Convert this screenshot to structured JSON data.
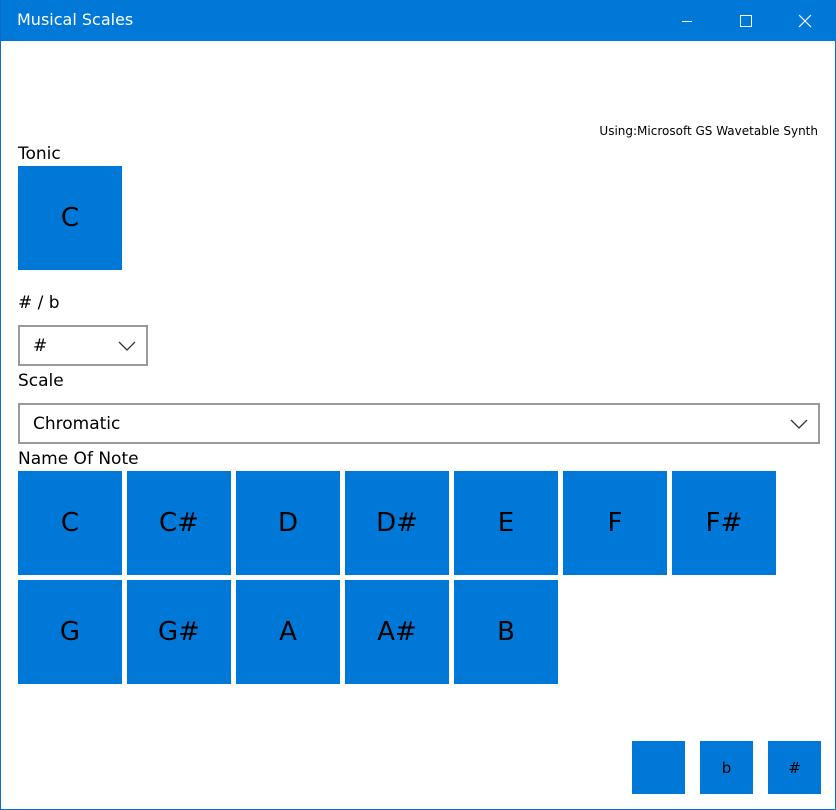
{
  "window": {
    "title": "Musical Scales"
  },
  "synth": {
    "text": "Using:Microsoft GS Wavetable Synth"
  },
  "tonic": {
    "label": "Tonic",
    "value": "C"
  },
  "accidental": {
    "label": "# / b",
    "selected": "#"
  },
  "scale": {
    "label": "Scale",
    "selected": "Chromatic"
  },
  "notes": {
    "label": "Name Of Note",
    "items": [
      "C",
      "C#",
      "D",
      "D#",
      "E",
      "F",
      "F#",
      "G",
      "G#",
      "A",
      "A#",
      "B"
    ]
  },
  "bottom_buttons": [
    "",
    "b",
    "#"
  ],
  "colors": {
    "accent": "#0078d7",
    "border": "#999999"
  }
}
